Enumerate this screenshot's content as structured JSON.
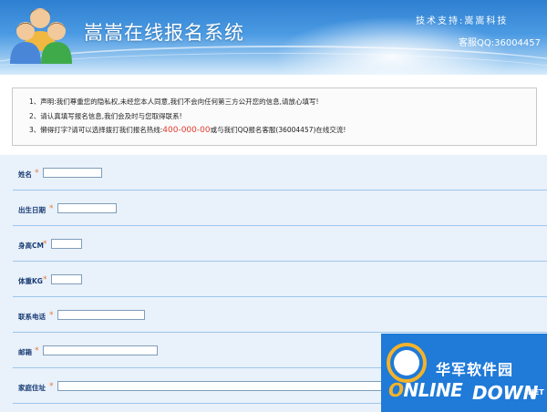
{
  "header": {
    "title": "嵩嵩在线报名系统",
    "support": "技术支持:嵩嵩科技",
    "qq": "客服QQ:36004457"
  },
  "notice": {
    "line1": "1、声明:我们尊重您的隐私权,未经您本人同意,我们不会向任何第三方公开您的信息,请放心填写!",
    "line2": "2、请认真填写报名信息,我们会及时与您取得联系!",
    "line3_pre": "3、懒得打字?请可以选择拨打我们报名热线:",
    "hotline": "400-000-00",
    "line3_post": "或与我们QQ报名客服(36004457)在线交流!"
  },
  "form": {
    "star": "*",
    "fields": [
      {
        "label": "姓名",
        "value": ""
      },
      {
        "label": "出生日期",
        "value": ""
      },
      {
        "label": "身高CM",
        "value": ""
      },
      {
        "label": "体重KG",
        "value": ""
      },
      {
        "label": "联系电话",
        "value": ""
      },
      {
        "label": "邮箱",
        "value": ""
      },
      {
        "label": "家庭住址",
        "value": ""
      }
    ]
  },
  "watermark": {
    "cn": "华军软件园",
    "en_o": "O",
    "en_rest": "NLINE",
    "down": "DOWN",
    "net": ".NET"
  },
  "colors": {
    "banner": "#4a9ae3",
    "label": "#1a3d73",
    "star": "#e6782b",
    "hotline": "#e03a2f",
    "form_bg": "#e9f1fb"
  }
}
